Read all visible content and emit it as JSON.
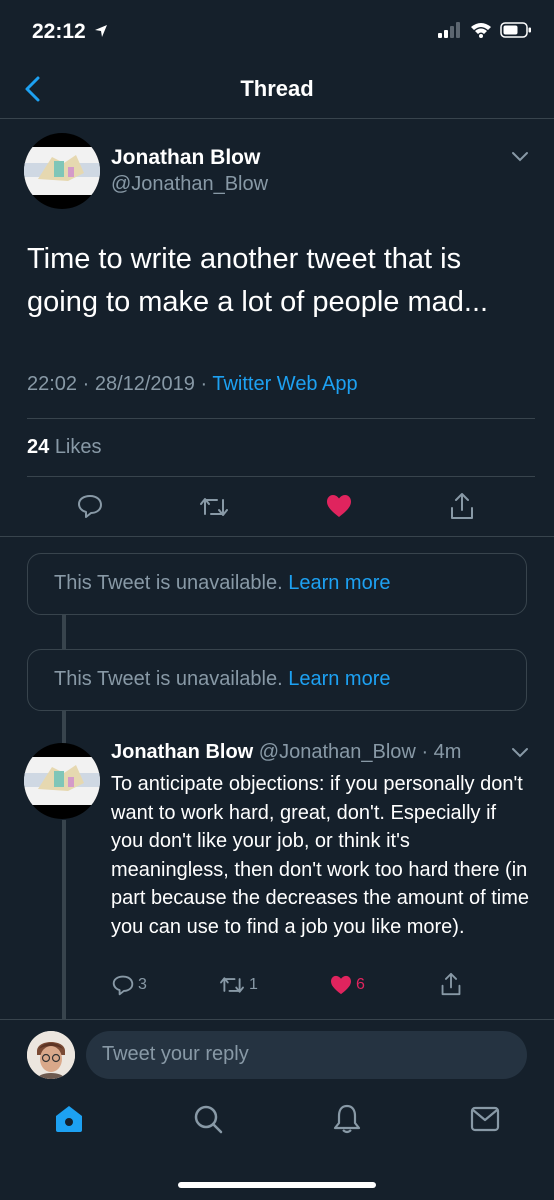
{
  "status_bar": {
    "time": "22:12"
  },
  "nav": {
    "title": "Thread"
  },
  "main_tweet": {
    "name": "Jonathan Blow",
    "handle": "@Jonathan_Blow",
    "text": "Time to write another tweet that is going to make a lot of people mad...",
    "time": "22:02 · 28/12/2019 · ",
    "source": "Twitter Web App",
    "likes_count": "24",
    "likes_label": "Likes"
  },
  "unavailable": [
    {
      "text": "This Tweet is unavailable. ",
      "link": "Learn more"
    },
    {
      "text": "This Tweet is unavailable. ",
      "link": "Learn more"
    }
  ],
  "reply_tweet": {
    "name": "Jonathan Blow",
    "handle": "@Jonathan_Blow",
    "age": "· 4m",
    "text": "To anticipate objections: if you personally don't want to work hard, great, don't. Especially if you don't like your job, or think it's meaningless, then don't work too hard there (in part because the decreases the amount of time you can use to find a job you like more).",
    "reply_count": "3",
    "retweet_count": "1",
    "like_count": "6"
  },
  "composer": {
    "placeholder": "Tweet your reply"
  },
  "colors": {
    "background": "#15202b",
    "accent": "#1da1f2",
    "like": "#e0245e",
    "muted": "#8899a6",
    "divider": "#38444d"
  },
  "icons": [
    "back-chevron",
    "chevron-down",
    "reply",
    "retweet",
    "heart",
    "share",
    "home",
    "search",
    "notifications",
    "messages"
  ]
}
